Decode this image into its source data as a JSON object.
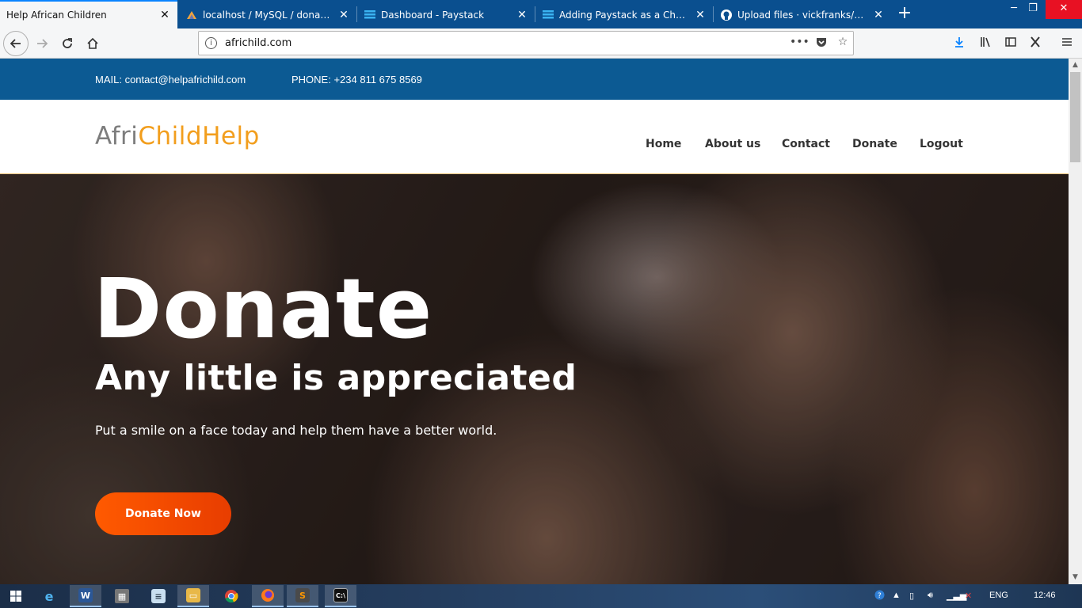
{
  "browser": {
    "tabs": [
      {
        "label": "Help African Children",
        "active": true,
        "icon": "page-icon"
      },
      {
        "label": "localhost / MySQL / donation |",
        "active": false,
        "icon": "phpmyadmin-icon"
      },
      {
        "label": "Dashboard - Paystack",
        "active": false,
        "icon": "paystack-icon"
      },
      {
        "label": "Adding Paystack as a Checkout",
        "active": false,
        "icon": "paystack-icon"
      },
      {
        "label": "Upload files · vickfranks/donati",
        "active": false,
        "icon": "github-icon"
      }
    ],
    "new_tab": "+",
    "url": "africhild.com",
    "window_controls": {
      "minimize": "─",
      "restore": "❐",
      "close": "✕"
    }
  },
  "site": {
    "contact_bar": {
      "mail": "MAIL: contact@helpafrichild.com",
      "phone": "PHONE: +234 811 675 8569"
    },
    "logo": {
      "part1": "Afri",
      "part2": "ChildHelp"
    },
    "nav": [
      "Home",
      "About us",
      "Contact",
      "Donate",
      "Logout"
    ],
    "hero": {
      "title": "Donate",
      "subtitle": "Any little is appreciated",
      "tagline": "Put a smile on a face today and help them have a better world.",
      "cta": "Donate Now"
    }
  },
  "taskbar": {
    "language": "ENG",
    "time": "12:46"
  },
  "colors": {
    "tabbar": "#0a4f8f",
    "contact_bar": "#0c5a93",
    "logo_gray": "#7d7d7d",
    "logo_orange": "#f29e1d",
    "cta": "#ff5a00"
  }
}
